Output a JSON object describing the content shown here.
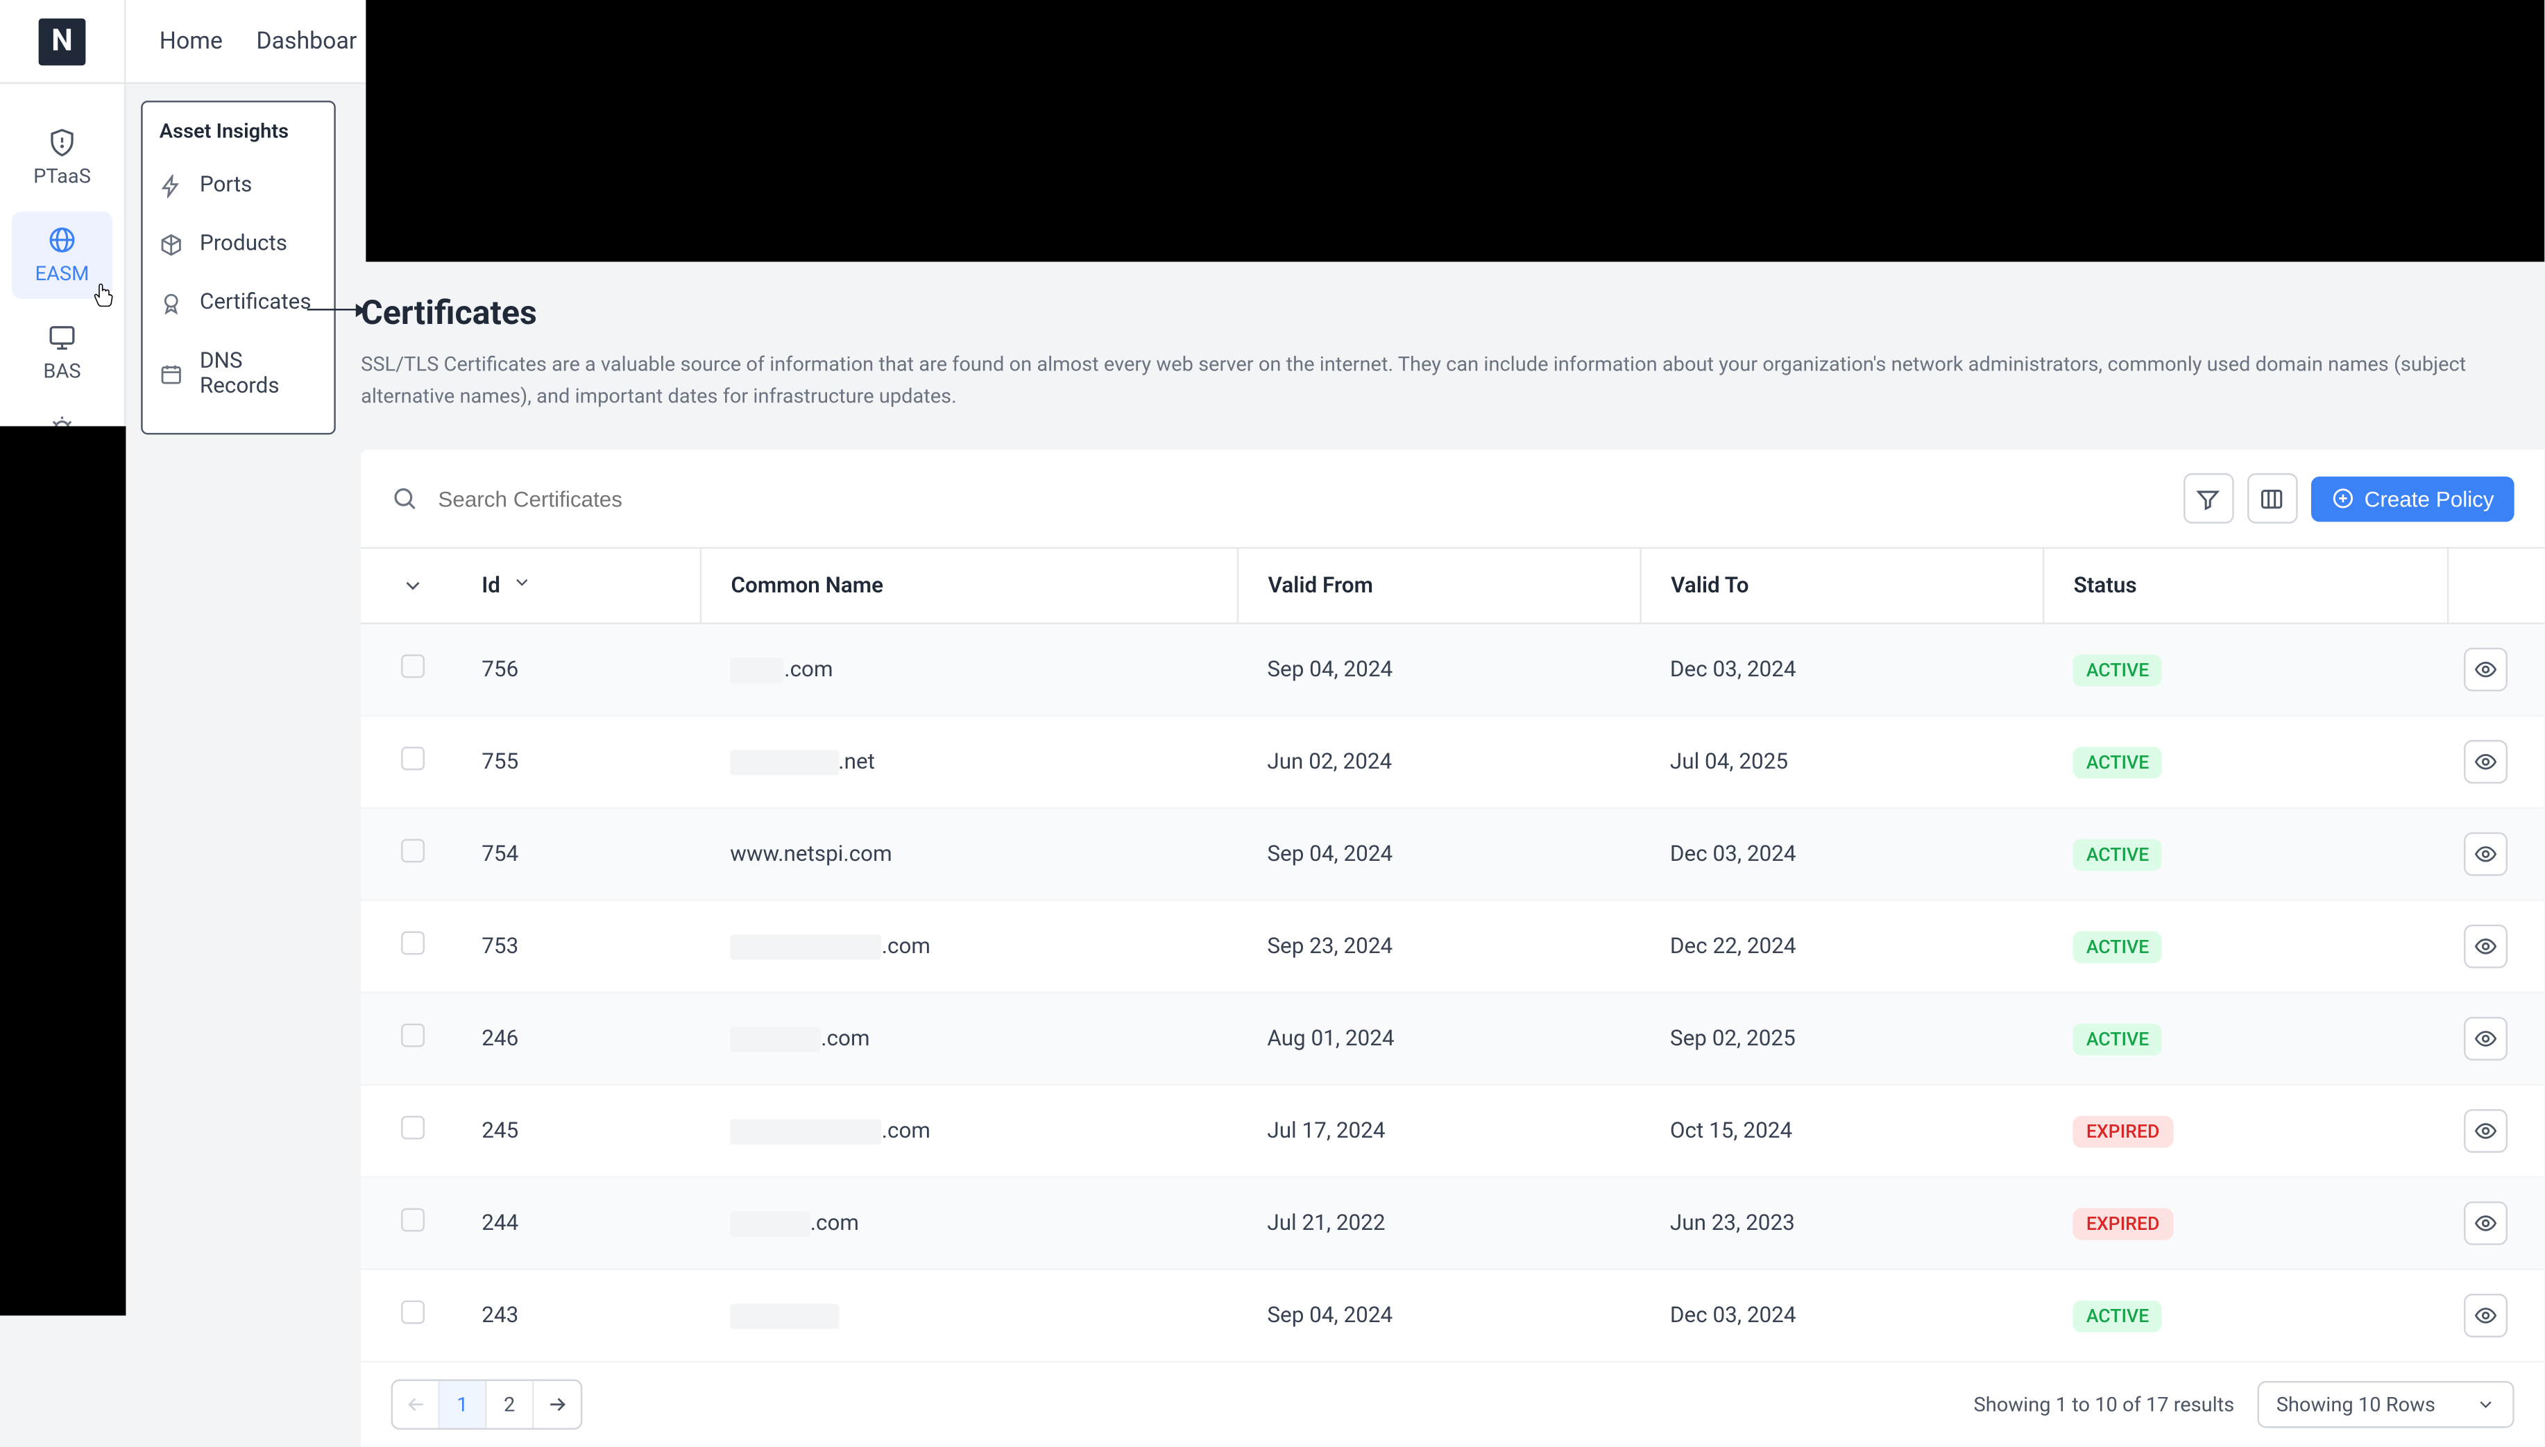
{
  "top_nav": {
    "items": [
      "Home",
      "Dashboar"
    ]
  },
  "left_sidebar": {
    "items": [
      {
        "label": "PTaaS"
      },
      {
        "label": "EASM"
      },
      {
        "label": "BAS"
      }
    ]
  },
  "flyout": {
    "title": "Asset Insights",
    "items": [
      {
        "label": "Ports"
      },
      {
        "label": "Products"
      },
      {
        "label": "Certificates"
      },
      {
        "label": "DNS Records"
      }
    ]
  },
  "page": {
    "title": "Certificates",
    "description": "SSL/TLS Certificates are a valuable source of information that are found on almost every web server on the internet. They can include information about your organization's network administrators, commonly used domain names (subject alternative names), and important dates for infrastructure updates."
  },
  "panel": {
    "search_placeholder": "Search Certificates",
    "create_button": "Create Policy"
  },
  "table": {
    "columns": {
      "id": "Id",
      "common_name": "Common Name",
      "valid_from": "Valid From",
      "valid_to": "Valid To",
      "status": "Status"
    },
    "rows": [
      {
        "id": "756",
        "cn_prefix": "xxxxx",
        "cn_suffix": ".com",
        "valid_from": "Sep 04, 2024",
        "valid_to": "Dec 03, 2024",
        "status": "ACTIVE",
        "status_class": "active"
      },
      {
        "id": "755",
        "cn_prefix": "xxxxxxxxxx",
        "cn_suffix": ".net",
        "valid_from": "Jun 02, 2024",
        "valid_to": "Jul 04, 2025",
        "status": "ACTIVE",
        "status_class": "active"
      },
      {
        "id": "754",
        "cn_prefix": "",
        "cn_suffix": "www.netspi.com",
        "valid_from": "Sep 04, 2024",
        "valid_to": "Dec 03, 2024",
        "status": "ACTIVE",
        "status_class": "active"
      },
      {
        "id": "753",
        "cn_prefix": "xxxxxxxxxxxxxx",
        "cn_suffix": ".com",
        "valid_from": "Sep 23, 2024",
        "valid_to": "Dec 22, 2024",
        "status": "ACTIVE",
        "status_class": "active"
      },
      {
        "id": "246",
        "cn_prefix": "*.xxxxxxx",
        "cn_suffix": ".com",
        "valid_from": "Aug 01, 2024",
        "valid_to": "Sep 02, 2025",
        "status": "ACTIVE",
        "status_class": "active"
      },
      {
        "id": "245",
        "cn_prefix": "xxxxxxxxxxxxxx",
        "cn_suffix": ".com",
        "valid_from": "Jul 17, 2024",
        "valid_to": "Oct 15, 2024",
        "status": "EXPIRED",
        "status_class": "expired"
      },
      {
        "id": "244",
        "cn_prefix": "*.xxxxxx",
        "cn_suffix": ".com",
        "valid_from": "Jul 21, 2022",
        "valid_to": "Jun 23, 2023",
        "status": "EXPIRED",
        "status_class": "expired"
      },
      {
        "id": "243",
        "cn_prefix": "xxxxxxxxxx",
        "cn_suffix": "",
        "valid_from": "Sep 04, 2024",
        "valid_to": "Dec 03, 2024",
        "status": "ACTIVE",
        "status_class": "active"
      }
    ]
  },
  "footer": {
    "results_text": "Showing 1 to 10 of 17 results",
    "rows_text": "Showing 10 Rows",
    "pages": [
      "1",
      "2"
    ]
  }
}
